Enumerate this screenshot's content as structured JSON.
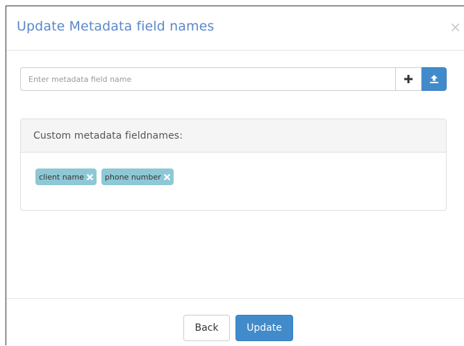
{
  "dialog": {
    "title": "Update Metadata field names",
    "close_label": "×"
  },
  "field_input": {
    "placeholder": "Enter metadata field name",
    "value": "",
    "add_icon": "plus-icon",
    "upload_icon": "upload-icon"
  },
  "custom_fields": {
    "heading": "Custom metadata fieldnames:",
    "tags": [
      {
        "label": "client name",
        "remove_icon": "remove-icon"
      },
      {
        "label": "phone number",
        "remove_icon": "remove-icon"
      }
    ]
  },
  "footer": {
    "back_label": "Back",
    "update_label": "Update"
  },
  "colors": {
    "title": "#5b88c9",
    "primary": "#428bca",
    "tag": "#8ec8d6"
  }
}
